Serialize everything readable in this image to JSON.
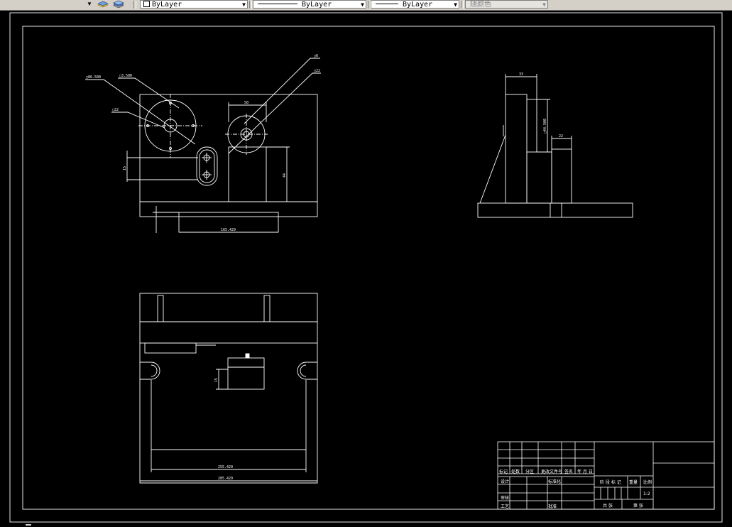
{
  "toolbar": {
    "color_control": "ByLayer",
    "linetype_control": "ByLayer",
    "lineweight_control": "ByLayer",
    "plotstyle_control": "随颜色"
  },
  "drawing": {
    "front_view": {
      "callout_1": "□86.500",
      "callout_2": "□3.500",
      "callout_3": "□22",
      "callout_4": "□6",
      "callout_5": "□22",
      "dim_top": "50",
      "dim_left": "15",
      "dim_right": "44",
      "dim_bottom": "165.429"
    },
    "side_view": {
      "dim_top": "33",
      "dim_vertical": "□44.500",
      "dim_small": "22"
    },
    "bottom_view": {
      "dim_left": "15",
      "dim_inner": "255.429",
      "dim_outer": "285.429"
    },
    "title_block": {
      "header_mark": "标记",
      "header_count": "处数",
      "header_zone": "分区",
      "header_docno": "更改文件号",
      "header_sign": "签名",
      "header_date": "年 月 日",
      "row_design": "设计",
      "row_standardize": "标准化",
      "row_review": "审核",
      "row_process": "工艺",
      "row_approve": "批准",
      "stage_label": "阶 段 标 记",
      "weight_label": "重量",
      "scale_label": "比例",
      "scale_value": "1:2",
      "sheets_total": "共  张",
      "sheet_no": "第  张"
    }
  }
}
